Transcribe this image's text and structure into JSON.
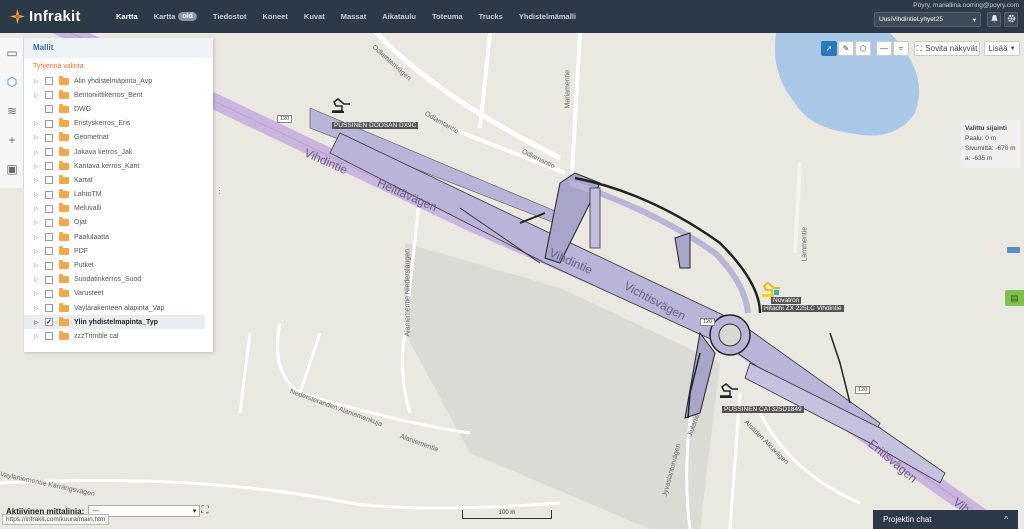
{
  "app": {
    "brand": "Infrakit"
  },
  "nav": [
    {
      "label": "Kartta",
      "active": true
    },
    {
      "label": "Kartta",
      "badge": "old"
    },
    {
      "label": "Tiedostot"
    },
    {
      "label": "Koneet"
    },
    {
      "label": "Kuvat"
    },
    {
      "label": "Massat"
    },
    {
      "label": "Aikataulu"
    },
    {
      "label": "Toteuma"
    },
    {
      "label": "Trucks"
    },
    {
      "label": "Yhdistelmämalli"
    }
  ],
  "user": {
    "email": "Pöyry, mariallina.norring@poyry.com"
  },
  "project": {
    "selected": "UusiVihdintieLyhyet25"
  },
  "top_icons": [
    "bell-icon",
    "gear-icon"
  ],
  "panel": {
    "title": "Mallit",
    "clear_label": "Tyhjennä valinta",
    "layers": [
      {
        "name": "Alin yhdistelmäpinta_Avp",
        "checked": false,
        "expandable": true
      },
      {
        "name": "Bentoniittikerros_Bent",
        "checked": false,
        "expandable": true
      },
      {
        "name": "DWG",
        "checked": false,
        "expandable": false
      },
      {
        "name": "Eristyskerros_Eris",
        "checked": false,
        "expandable": true
      },
      {
        "name": "Geometriat",
        "checked": false,
        "expandable": true
      },
      {
        "name": "Jakava kerros_Jak",
        "checked": false,
        "expandable": true
      },
      {
        "name": "Kantava kerros_Kant",
        "checked": false,
        "expandable": true
      },
      {
        "name": "Kartat",
        "checked": false,
        "expandable": true
      },
      {
        "name": "LahtoTM",
        "checked": false,
        "expandable": true
      },
      {
        "name": "Meluvalli",
        "checked": false,
        "expandable": true
      },
      {
        "name": "Ojat",
        "checked": false,
        "expandable": true
      },
      {
        "name": "Paalulaatta",
        "checked": false,
        "expandable": true
      },
      {
        "name": "PDF",
        "checked": false,
        "expandable": true
      },
      {
        "name": "Putket",
        "checked": false,
        "expandable": true
      },
      {
        "name": "Suodatinkerros_Suod",
        "checked": false,
        "expandable": true
      },
      {
        "name": "Varusteet",
        "checked": false,
        "expandable": true
      },
      {
        "name": "Vaylarakenteen alapinta_Vap",
        "checked": false,
        "expandable": true
      },
      {
        "name": "Ylin yhdistelmapinta_Typ",
        "checked": true,
        "expandable": true,
        "selected": true
      },
      {
        "name": "zzzTrimble cal",
        "checked": false,
        "expandable": true
      }
    ]
  },
  "map_controls": {
    "fit_label": "Sovita näkyvät",
    "more_label": "Lisää",
    "more_caret": "▼",
    "tools": [
      "pointer-icon",
      "ruler-icon",
      "polygon-icon",
      "minus-icon",
      "wave-icon"
    ]
  },
  "location_info": {
    "title": "Valittu sijainti",
    "station": "Paalu: 0 m",
    "offset": "Sivumitta: -670 m",
    "height": "a: -635 m"
  },
  "map_labels": {
    "roads": [
      "Vihdintie",
      "Helttävägen",
      "Vihdintie",
      "Vichtisvägen",
      "Eritisvägen",
      "Vih",
      "Odlamtantie",
      "Odlamtenvägen",
      "Odlamantie",
      "Mariamentie",
      "Lämmentie",
      "Alaniementie Niedersläugen",
      "Nedersteranden Alaniemenkuja",
      "Alaniementie",
      "Vaylaniementie Kärrängsvägen",
      "Jiulanie",
      "Jyvaslantorvägen",
      "Alsaden Alkuvägen"
    ],
    "shields": [
      "120",
      "120",
      "120"
    ],
    "machines": [
      "PUSSINEN DOOSAN DX9C",
      "Novatron",
      "Hitachi ZX 225LC Vihdintie",
      "PUSSINEN CAT325D1849"
    ]
  },
  "bottom": {
    "active_line_label": "Aktiivinen mittalinja:",
    "active_line_value": "---",
    "url": "https://infrakit.com/kuura/main.htm",
    "scale": "100 m",
    "chat_label": "Projektin chat",
    "chat_caret": "^"
  },
  "colors": {
    "topbar": "#2c3a47",
    "accent": "#2a7ab5",
    "road_purple": "#c9b5de",
    "model_fill": "#b8b5d8",
    "water": "#a9c8e8",
    "folder": "#f3a74b"
  }
}
